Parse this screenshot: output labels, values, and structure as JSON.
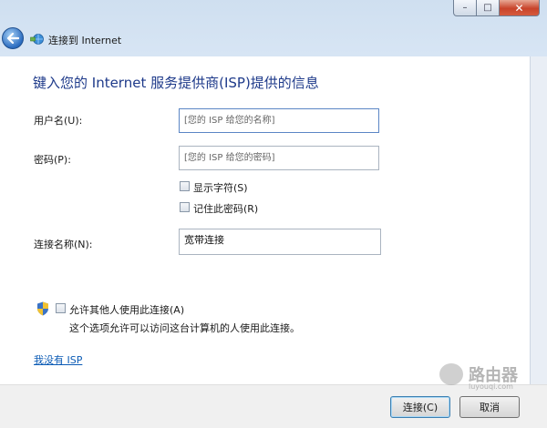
{
  "window": {
    "controls": {
      "minimize": "–",
      "maximize": "□",
      "close": "✕"
    }
  },
  "nav": {
    "title": "连接到 Internet",
    "back_icon": "back-arrow-icon",
    "network_icon": "network-icon"
  },
  "form": {
    "heading": "键入您的 Internet 服务提供商(ISP)提供的信息",
    "username": {
      "label": "用户名(U):",
      "value": "",
      "placeholder": "[您的 ISP 给您的名称]"
    },
    "password": {
      "label": "密码(P):",
      "value": "",
      "placeholder": "[您的 ISP 给您的密码]"
    },
    "show_chars": {
      "label": "显示字符(S)",
      "checked": false
    },
    "remember_password": {
      "label": "记住此密码(R)",
      "checked": false
    },
    "connection_name": {
      "label": "连接名称(N):",
      "value": "宽带连接"
    },
    "allow_others": {
      "label": "允许其他人使用此连接(A)",
      "checked": false,
      "description": "这个选项允许可以访问这台计算机的人使用此连接。",
      "icon": "uac-shield-icon"
    },
    "no_isp_link": "我没有 ISP"
  },
  "footer": {
    "connect_button": "连接(C)",
    "cancel_button": "取消"
  },
  "watermark": {
    "text": "路由器",
    "subtext": "luyouqi.com"
  },
  "colors": {
    "heading": "#1e3a8a",
    "link": "#0b5bb5",
    "close_button": "#c8432a"
  }
}
